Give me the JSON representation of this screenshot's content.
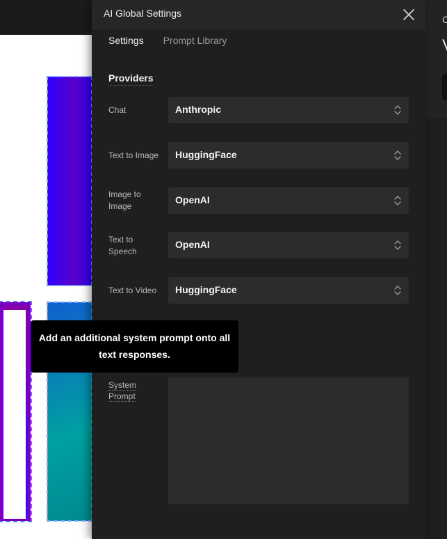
{
  "panel": {
    "title": "AI Global Settings",
    "tabs": [
      {
        "label": "Settings",
        "active": true
      },
      {
        "label": "Prompt Library",
        "active": false
      }
    ],
    "providers": {
      "heading": "Providers",
      "rows": [
        {
          "label": "Chat",
          "value": "Anthropic"
        },
        {
          "label": "Text to Image",
          "value": "HuggingFace"
        },
        {
          "label": "Image to Image",
          "value": "OpenAI"
        },
        {
          "label": "Text to Speech",
          "value": "OpenAI"
        },
        {
          "label": "Text to Video",
          "value": "HuggingFace"
        }
      ]
    },
    "system_prompt": {
      "label": "System Prompt",
      "value": "",
      "tooltip": "Add an additional system prompt onto all text responses."
    }
  },
  "background": {
    "right_letter_top": "C",
    "right_letter_big": "V"
  },
  "icons": {
    "close": "close-icon",
    "select_arrows": "chevron-up-down-icon"
  },
  "colors": {
    "panel_bg": "#1f1f1f",
    "header_bg": "#262626",
    "field_bg": "#2c2c2c",
    "tooltip_bg": "#000000"
  }
}
